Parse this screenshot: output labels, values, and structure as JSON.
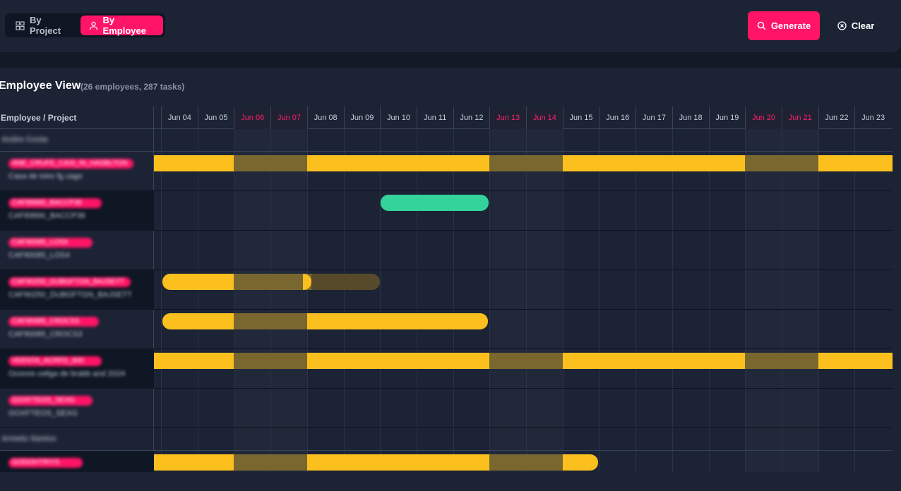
{
  "toolbar": {
    "by_project_label": "By Project",
    "by_employee_label": "By Employee",
    "generate_label": "Generate",
    "clear_label": "Clear"
  },
  "view": {
    "title": "Employee View",
    "meta": "(26 employees, 287 tasks)",
    "column_header": "Employee / Project"
  },
  "dates": [
    "Jun 04",
    "Jun 05",
    "Jun 06",
    "Jun 07",
    "Jun 08",
    "Jun 09",
    "Jun 10",
    "Jun 11",
    "Jun 12",
    "Jun 13",
    "Jun 14",
    "Jun 15",
    "Jun 16",
    "Jun 17",
    "Jun 18",
    "Jun 19",
    "Jun 20",
    "Jun 21",
    "Jun 22",
    "Jun 23"
  ],
  "weekend_dates": [
    "Jun 06",
    "Jun 07",
    "Jun 13",
    "Jun 14",
    "Jun 20",
    "Jun 21"
  ],
  "colors": {
    "accent": "#ff1466",
    "task_bar": "#fbc01e",
    "task_bar_weekend": "#7a6730",
    "task_bar_green": "#34d39b"
  },
  "groups": [
    {
      "label": "Andre Costa",
      "rows": [
        {
          "name": "ANE_CRUFE_CASI_IN_HASBLTON",
          "project": "Casa de toiro fg cago"
        },
        {
          "name": "CAF89890_BACCP36",
          "project": "CAF89890_BACCP36"
        },
        {
          "name": "CAF90085_LOS4",
          "project": "CAF90085_LOS4"
        },
        {
          "name": "CAF90250_DUBGFTGN_BAJSETT",
          "project": "CAF90250_DUBGFTGN_BAJSETT"
        },
        {
          "name": "CAF90085_CROCS3",
          "project": "CAF90085_CROCS3"
        },
        {
          "name": "VEENTA_ACRFD_900",
          "project": "Oconos celiga de brabb and 2024"
        },
        {
          "name": "GOXFTEOS_SEXG",
          "project": "GOXFTEOS_SEXG"
        }
      ]
    },
    {
      "label": "Armelo Santos",
      "rows": [
        {
          "name": "GODOHTRIYS",
          "project": ""
        }
      ]
    }
  ]
}
